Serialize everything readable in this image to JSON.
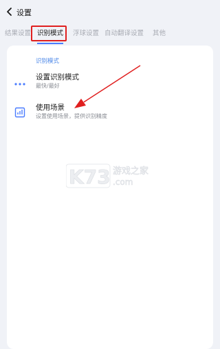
{
  "header": {
    "title": "设置",
    "back_icon": "chevron-left-icon"
  },
  "tabs": [
    {
      "label": "结果设置",
      "active": false
    },
    {
      "label": "识别模式",
      "active": true
    },
    {
      "label": "浮球设置",
      "active": false
    },
    {
      "label": "自动翻译设置",
      "active": false
    },
    {
      "label": "其他",
      "active": false
    }
  ],
  "section": {
    "label": "识别模式"
  },
  "rows": [
    {
      "title": "设置识别模式",
      "subtitle": "最快/最好",
      "icon": "more-dots-icon"
    },
    {
      "title": "使用场景",
      "subtitle": "设置使用场景，提供识别精度",
      "icon": "bar-chart-icon"
    }
  ],
  "watermark": {
    "brand": "K73",
    "text": "游戏之家",
    "suffix": ".com"
  },
  "colors": {
    "accent": "#4a7cff",
    "annotation_red": "#e01f1f",
    "background": "#f0f2f7"
  }
}
